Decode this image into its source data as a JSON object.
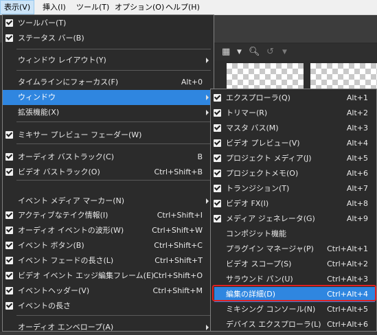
{
  "menubar": {
    "items": [
      "表示(V)",
      "挿入(I)",
      "ツール(T)",
      "オプション(O)",
      "ヘルプ(H)"
    ]
  },
  "main_menu": {
    "items": [
      {
        "label": "ツールバー(T)",
        "checked": true,
        "shortcut": ""
      },
      {
        "label": "ステータス バー(B)",
        "checked": true,
        "shortcut": ""
      },
      {
        "label": "ウィンドウ レイアウト(Y)",
        "checked": false,
        "shortcut": "",
        "submenu": true
      },
      {
        "label": "タイムラインにフォーカス(F)",
        "checked": false,
        "shortcut": "Alt+0"
      },
      {
        "label": "ウィンドウ",
        "checked": false,
        "shortcut": "",
        "submenu": true,
        "selected": true
      },
      {
        "label": "拡張機能(X)",
        "checked": false,
        "shortcut": "",
        "submenu": true
      },
      {
        "label": "ミキサー プレビュー フェーダー(W)",
        "checked": true,
        "shortcut": ""
      },
      {
        "label": "オーディオ バストラック(C)",
        "checked": true,
        "shortcut": "B"
      },
      {
        "label": "ビデオ バストラック(O)",
        "checked": true,
        "shortcut": "Ctrl+Shift+B"
      },
      {
        "label": "イベント メディア マーカー(N)",
        "checked": false,
        "shortcut": "",
        "submenu": true
      },
      {
        "label": "アクティブなテイク情報(I)",
        "checked": true,
        "shortcut": "Ctrl+Shift+I"
      },
      {
        "label": "オーディオ イベントの波形(W)",
        "checked": true,
        "shortcut": "Ctrl+Shift+W"
      },
      {
        "label": "イベント ボタン(B)",
        "checked": true,
        "shortcut": "Ctrl+Shift+C"
      },
      {
        "label": "イベント フェードの長さ(L)",
        "checked": true,
        "shortcut": "Ctrl+Shift+T"
      },
      {
        "label": "ビデオ イベント エッジ編集フレーム(E)",
        "checked": true,
        "shortcut": "Ctrl+Shift+O"
      },
      {
        "label": "イベントヘッダー(V)",
        "checked": true,
        "shortcut": "Ctrl+Shift+M"
      },
      {
        "label": "イベントの長さ",
        "checked": true,
        "shortcut": ""
      },
      {
        "label": "オーディオ エンベロープ(A)",
        "checked": false,
        "shortcut": "",
        "submenu": true
      }
    ]
  },
  "window_submenu": {
    "items": [
      {
        "label": "エクスプローラ(Q)",
        "checked": true,
        "shortcut": "Alt+1"
      },
      {
        "label": "トリマー(R)",
        "checked": true,
        "shortcut": "Alt+2"
      },
      {
        "label": "マスタ バス(M)",
        "checked": true,
        "shortcut": "Alt+3"
      },
      {
        "label": "ビデオ プレビュー(V)",
        "checked": true,
        "shortcut": "Alt+4"
      },
      {
        "label": "プロジェクト メディア(J)",
        "checked": true,
        "shortcut": "Alt+5"
      },
      {
        "label": "プロジェクトメモ(O)",
        "checked": true,
        "shortcut": "Alt+6"
      },
      {
        "label": "トランジション(T)",
        "checked": true,
        "shortcut": "Alt+7"
      },
      {
        "label": "ビデオ FX(I)",
        "checked": true,
        "shortcut": "Alt+8"
      },
      {
        "label": "メディア ジェネレータ(G)",
        "checked": true,
        "shortcut": "Alt+9"
      },
      {
        "label": "コンポジット機能",
        "checked": false,
        "shortcut": ""
      },
      {
        "label": "プラグイン マネージャ(P)",
        "checked": false,
        "shortcut": "Ctrl+Alt+1"
      },
      {
        "label": "ビデオ スコープ(S)",
        "checked": false,
        "shortcut": "Ctrl+Alt+2"
      },
      {
        "label": "サラウンド パン(U)",
        "checked": false,
        "shortcut": "Ctrl+Alt+3"
      },
      {
        "label": "編集の詳細(D)",
        "checked": false,
        "shortcut": "Ctrl+Alt+4",
        "selected": true
      },
      {
        "label": "ミキシング コンソール(N)",
        "checked": false,
        "shortcut": "Ctrl+Alt+5"
      },
      {
        "label": "デバイス エクスプローラ(L)",
        "checked": false,
        "shortcut": "Ctrl+Alt+6"
      }
    ]
  },
  "colors": {
    "menu_bg": "#2b2b2b",
    "selection": "#2f86e0",
    "highlight_outline": "#e02020"
  }
}
